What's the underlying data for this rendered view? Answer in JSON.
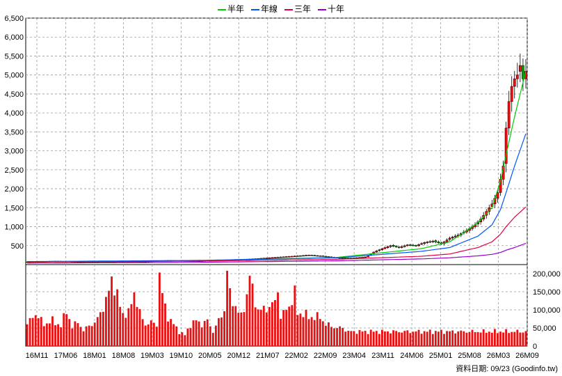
{
  "legend": [
    {
      "label": "半年",
      "color": "#00cc00"
    },
    {
      "label": "年線",
      "color": "#0055ff"
    },
    {
      "label": "三年",
      "color": "#e0003c"
    },
    {
      "label": "十年",
      "color": "#9900cc"
    }
  ],
  "footer": {
    "date_label": "資料日期: 09/23",
    "source": "(Goodinfo.tw)"
  },
  "chart_data": {
    "type": "candlestick-volume",
    "x_ticks": [
      "16M11",
      "17M06",
      "18M01",
      "18M08",
      "19M03",
      "19M10",
      "20M05",
      "20M12",
      "21M07",
      "22M02",
      "22M09",
      "23M04",
      "23M11",
      "24M06",
      "25M01",
      "25M08",
      "26M03",
      "26M09"
    ],
    "price_axis": {
      "ticks": [
        500,
        1000,
        1500,
        2000,
        2500,
        3000,
        3500,
        4000,
        4500,
        5000,
        5500,
        6000,
        6500
      ],
      "ylim": [
        0,
        6500
      ]
    },
    "volume_axis": {
      "ticks": [
        0,
        50000,
        100000,
        150000,
        200000
      ],
      "tick_labels": [
        "0",
        "50,000",
        "100,000",
        "150,000",
        "200,000"
      ],
      "ylim": [
        0,
        225000
      ]
    },
    "price_anchors": [
      [
        0,
        70
      ],
      [
        10,
        90
      ],
      [
        20,
        75
      ],
      [
        30,
        70
      ],
      [
        40,
        80
      ],
      [
        50,
        110
      ],
      [
        60,
        95
      ],
      [
        70,
        120
      ],
      [
        80,
        150
      ],
      [
        90,
        200
      ],
      [
        100,
        250
      ],
      [
        105,
        220
      ],
      [
        110,
        180
      ],
      [
        115,
        170
      ],
      [
        120,
        200
      ],
      [
        123,
        330
      ],
      [
        126,
        420
      ],
      [
        129,
        500
      ],
      [
        132,
        450
      ],
      [
        135,
        520
      ],
      [
        138,
        500
      ],
      [
        141,
        580
      ],
      [
        144,
        620
      ],
      [
        147,
        550
      ],
      [
        150,
        700
      ],
      [
        153,
        780
      ],
      [
        156,
        900
      ],
      [
        159,
        1050
      ],
      [
        161,
        1200
      ],
      [
        163,
        1400
      ],
      [
        165,
        1600
      ],
      [
        167,
        1900
      ],
      [
        169,
        2600
      ],
      [
        170,
        3600
      ],
      [
        171,
        4300
      ],
      [
        172,
        4700
      ],
      [
        173,
        4900
      ],
      [
        174,
        5000
      ],
      [
        175,
        5250
      ],
      [
        176,
        4900
      ],
      [
        177,
        5100
      ]
    ],
    "volume_anchors": [
      [
        0,
        60000
      ],
      [
        3,
        90000
      ],
      [
        6,
        60000
      ],
      [
        9,
        70000
      ],
      [
        12,
        55000
      ],
      [
        14,
        100000
      ],
      [
        16,
        50000
      ],
      [
        18,
        70000
      ],
      [
        20,
        40000
      ],
      [
        22,
        60000
      ],
      [
        24,
        60000
      ],
      [
        26,
        95000
      ],
      [
        28,
        120000
      ],
      [
        30,
        190000
      ],
      [
        32,
        135000
      ],
      [
        34,
        90000
      ],
      [
        36,
        90000
      ],
      [
        38,
        150000
      ],
      [
        40,
        90000
      ],
      [
        42,
        60000
      ],
      [
        44,
        65000
      ],
      [
        46,
        60000
      ],
      [
        47,
        200000
      ],
      [
        48,
        140000
      ],
      [
        50,
        80000
      ],
      [
        52,
        60000
      ],
      [
        54,
        40000
      ],
      [
        56,
        30000
      ],
      [
        58,
        60000
      ],
      [
        60,
        70000
      ],
      [
        62,
        60000
      ],
      [
        64,
        70000
      ],
      [
        66,
        40000
      ],
      [
        68,
        70000
      ],
      [
        70,
        100000
      ],
      [
        71,
        210000
      ],
      [
        72,
        140000
      ],
      [
        74,
        110000
      ],
      [
        76,
        80000
      ],
      [
        78,
        140000
      ],
      [
        79,
        200000
      ],
      [
        80,
        150000
      ],
      [
        82,
        100000
      ],
      [
        84,
        100000
      ],
      [
        86,
        110000
      ],
      [
        88,
        120000
      ],
      [
        89,
        160000
      ],
      [
        90,
        80000
      ],
      [
        92,
        100000
      ],
      [
        94,
        125000
      ],
      [
        95,
        145000
      ],
      [
        96,
        90000
      ],
      [
        98,
        90000
      ],
      [
        100,
        80000
      ],
      [
        102,
        80000
      ],
      [
        104,
        80000
      ],
      [
        106,
        60000
      ],
      [
        108,
        55000
      ],
      [
        110,
        50000
      ],
      [
        112,
        50000
      ],
      [
        114,
        40000
      ]
    ],
    "ma_lines": [
      {
        "name": "半年",
        "color": "#00cc00",
        "points": [
          [
            0,
            70
          ],
          [
            60,
            100
          ],
          [
            110,
            190
          ],
          [
            140,
            420
          ],
          [
            150,
            600
          ],
          [
            160,
            1100
          ],
          [
            165,
            1500
          ],
          [
            168,
            2200
          ],
          [
            170,
            2900
          ],
          [
            173,
            3900
          ],
          [
            177,
            5100
          ]
        ]
      },
      {
        "name": "年線",
        "color": "#0055ff",
        "points": [
          [
            0,
            80
          ],
          [
            60,
            110
          ],
          [
            110,
            180
          ],
          [
            140,
            350
          ],
          [
            150,
            450
          ],
          [
            160,
            750
          ],
          [
            165,
            1050
          ],
          [
            168,
            1450
          ],
          [
            170,
            1900
          ],
          [
            173,
            2600
          ],
          [
            177,
            3450
          ]
        ]
      },
      {
        "name": "三年",
        "color": "#e0003c",
        "points": [
          [
            0,
            70
          ],
          [
            60,
            90
          ],
          [
            110,
            140
          ],
          [
            140,
            220
          ],
          [
            150,
            280
          ],
          [
            160,
            450
          ],
          [
            165,
            600
          ],
          [
            168,
            800
          ],
          [
            170,
            1000
          ],
          [
            173,
            1250
          ],
          [
            177,
            1520
          ]
        ]
      },
      {
        "name": "十年",
        "color": "#9900cc",
        "points": [
          [
            0,
            40
          ],
          [
            60,
            60
          ],
          [
            110,
            100
          ],
          [
            140,
            150
          ],
          [
            150,
            180
          ],
          [
            160,
            230
          ],
          [
            165,
            270
          ],
          [
            168,
            320
          ],
          [
            170,
            380
          ],
          [
            173,
            450
          ],
          [
            177,
            560
          ]
        ]
      }
    ]
  }
}
